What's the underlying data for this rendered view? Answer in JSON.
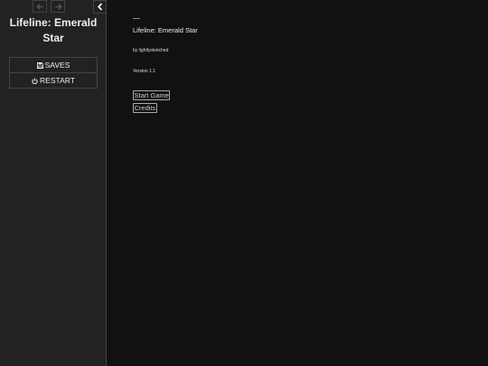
{
  "sidebar": {
    "history_back_icon": "arrow-left-icon",
    "history_forward_icon": "arrow-right-icon",
    "toggle_icon": "chevron-left-icon",
    "story_title": "Lifeline: Emerald Star",
    "menu": {
      "saves_label": "SAVES",
      "saves_icon": "floppy-disk-icon",
      "restart_label": "RESTART",
      "restart_icon": "power-icon"
    }
  },
  "passage": {
    "title": "Lifeline: Emerald Star",
    "byline": "by lightlysketched",
    "version": "Version 1.1",
    "links": {
      "start": "Start Game",
      "credits": "Credits"
    }
  },
  "colors": {
    "page_background": "#111111",
    "sidebar_background": "#222222",
    "border": "#444444",
    "text": "#eeeeee"
  }
}
